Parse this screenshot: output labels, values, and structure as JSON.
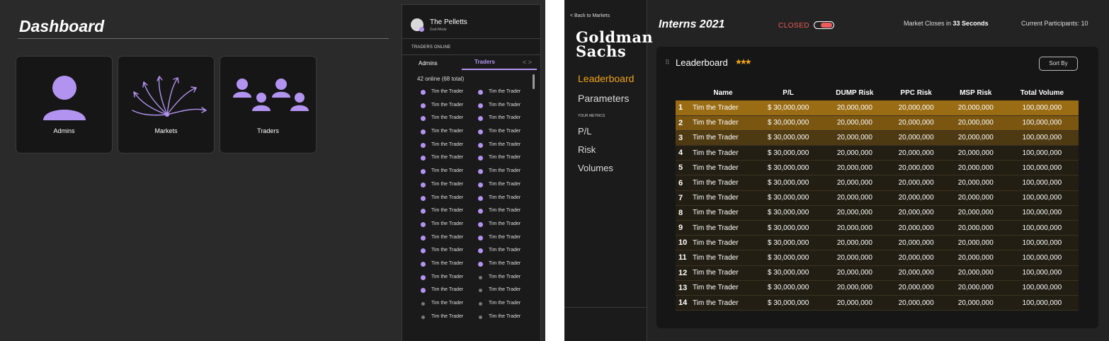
{
  "dashboard": {
    "title": "Dashboard",
    "cards": [
      {
        "label": "Admins",
        "icon": "person-icon"
      },
      {
        "label": "Markets",
        "icon": "branching-arrows-icon"
      },
      {
        "label": "Traders",
        "icon": "group-icon"
      }
    ],
    "sidebar": {
      "user_name": "The Pelletts",
      "user_role": "God-Mode",
      "section_title": "TRADERS ONLINE",
      "tabs": [
        "Admins",
        "Traders"
      ],
      "tab_arrows": "< >",
      "online_count": "42 online (68 total)",
      "trader_name": "Tim the Trader",
      "accent_color": "#b294f0",
      "col1_online": [
        true,
        true,
        true,
        true,
        true,
        true,
        true,
        true,
        true,
        true,
        true,
        true,
        true,
        true,
        true,
        true,
        false,
        false
      ],
      "col2_online": [
        true,
        true,
        true,
        true,
        true,
        true,
        true,
        true,
        true,
        true,
        true,
        true,
        true,
        true,
        false,
        false,
        false,
        false
      ]
    }
  },
  "leaderboard_app": {
    "back_link": "< Back to Markets",
    "logo_line1": "Goldman",
    "logo_line2": "Sachs",
    "nav": {
      "leaderboard": "Leaderboard",
      "parameters": "Parameters",
      "your_metrics": "YOUR METRICS",
      "pl": "P/L",
      "risk": "Risk",
      "volumes": "Volumes"
    },
    "market_title": "Interns 2021",
    "status": "CLOSED",
    "closes_prefix": "Market Closes in",
    "closes_value": "33 Seconds",
    "participants": "Current Participants: 10",
    "board_title": "Leaderboard",
    "sort_by": "Sort By",
    "accent_color": "#f0a419",
    "columns": [
      "Name",
      "P/L",
      "DUMP Risk",
      "PPC Risk",
      "MSP Risk",
      "Total Volume"
    ],
    "rows": [
      [
        "1",
        "Tim the Trader",
        "$ 30,000,000",
        "20,000,000",
        "20,000,000",
        "20,000,000",
        "100,000,000"
      ],
      [
        "2",
        "Tim the Trader",
        "$ 30,000,000",
        "20,000,000",
        "20,000,000",
        "20,000,000",
        "100,000,000"
      ],
      [
        "3",
        "Tim the Trader",
        "$ 30,000,000",
        "20,000,000",
        "20,000,000",
        "20,000,000",
        "100,000,000"
      ],
      [
        "4",
        "Tim the Trader",
        "$ 30,000,000",
        "20,000,000",
        "20,000,000",
        "20,000,000",
        "100,000,000"
      ],
      [
        "5",
        "Tim the Trader",
        "$ 30,000,000",
        "20,000,000",
        "20,000,000",
        "20,000,000",
        "100,000,000"
      ],
      [
        "6",
        "Tim the Trader",
        "$ 30,000,000",
        "20,000,000",
        "20,000,000",
        "20,000,000",
        "100,000,000"
      ],
      [
        "7",
        "Tim the Trader",
        "$ 30,000,000",
        "20,000,000",
        "20,000,000",
        "20,000,000",
        "100,000,000"
      ],
      [
        "8",
        "Tim the Trader",
        "$ 30,000,000",
        "20,000,000",
        "20,000,000",
        "20,000,000",
        "100,000,000"
      ],
      [
        "9",
        "Tim the Trader",
        "$ 30,000,000",
        "20,000,000",
        "20,000,000",
        "20,000,000",
        "100,000,000"
      ],
      [
        "10",
        "Tim the Trader",
        "$ 30,000,000",
        "20,000,000",
        "20,000,000",
        "20,000,000",
        "100,000,000"
      ],
      [
        "11",
        "Tim the Trader",
        "$ 30,000,000",
        "20,000,000",
        "20,000,000",
        "20,000,000",
        "100,000,000"
      ],
      [
        "12",
        "Tim the Trader",
        "$ 30,000,000",
        "20,000,000",
        "20,000,000",
        "20,000,000",
        "100,000,000"
      ],
      [
        "13",
        "Tim the Trader",
        "$ 30,000,000",
        "20,000,000",
        "20,000,000",
        "20,000,000",
        "100,000,000"
      ],
      [
        "14",
        "Tim the Trader",
        "$ 30,000,000",
        "20,000,000",
        "20,000,000",
        "20,000,000",
        "100,000,000"
      ]
    ]
  }
}
